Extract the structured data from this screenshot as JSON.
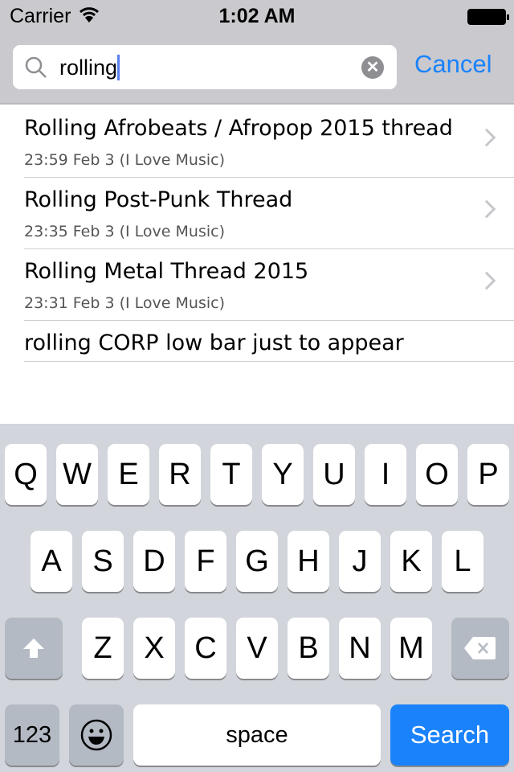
{
  "status_bar": {
    "carrier": "Carrier",
    "time": "1:02 AM",
    "wifi_icon": "wifi-icon",
    "battery_icon": "battery-icon"
  },
  "search": {
    "query": "rolling",
    "cancel_label": "Cancel",
    "clear_icon": "clear-icon",
    "search_icon": "magnifier-icon"
  },
  "results": [
    {
      "title": "Rolling Afrobeats / Afropop 2015 thread",
      "subtitle": "23:59 Feb 3 (I Love Music)"
    },
    {
      "title": "Rolling Post-Punk Thread",
      "subtitle": "23:35 Feb 3 (I Love Music)"
    },
    {
      "title": "Rolling Metal Thread 2015",
      "subtitle": "23:31 Feb 3 (I Love Music)"
    },
    {
      "title": "rolling CORP low bar just to appear",
      "subtitle": ""
    }
  ],
  "keyboard": {
    "row1": [
      "Q",
      "W",
      "E",
      "R",
      "T",
      "Y",
      "U",
      "I",
      "O",
      "P"
    ],
    "row2": [
      "A",
      "S",
      "D",
      "F",
      "G",
      "H",
      "J",
      "K",
      "L"
    ],
    "row3": [
      "Z",
      "X",
      "C",
      "V",
      "B",
      "N",
      "M"
    ],
    "numbers_label": "123",
    "space_label": "space",
    "search_label": "Search",
    "accent": "#1a82fb"
  }
}
